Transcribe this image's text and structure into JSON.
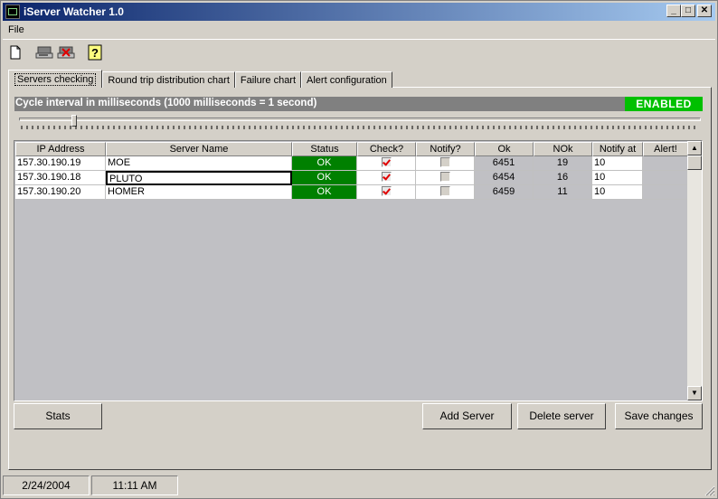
{
  "window": {
    "title": "iServer Watcher 1.0",
    "min_label": "_",
    "max_label": "□",
    "close_label": "✕"
  },
  "menu": {
    "items": [
      "File"
    ]
  },
  "toolbar": {
    "icons": [
      "new-document-icon",
      "server-icon",
      "delete-server-icon",
      "help-icon"
    ]
  },
  "tabs": [
    {
      "label": "Servers checking",
      "active": true
    },
    {
      "label": "Round trip distribution chart",
      "active": false
    },
    {
      "label": "Failure chart",
      "active": false
    },
    {
      "label": "Alert configuration",
      "active": false
    }
  ],
  "cycle": {
    "label": "Cycle interval in milliseconds (1000 milliseconds = 1 second)",
    "state": "ENABLED",
    "slider_level": 0.08
  },
  "grid": {
    "columns": [
      "IP Address",
      "Server Name",
      "Status",
      "Check?",
      "Notify?",
      "Ok",
      "NOk",
      "Notify at",
      "Alert!"
    ],
    "rows": [
      {
        "ip": "157.30.190.19",
        "name": "MOE",
        "status": "OK",
        "check": true,
        "notify": false,
        "ok": "6451",
        "nok": "19",
        "notify_at": "10",
        "alert": ""
      },
      {
        "ip": "157.30.190.18",
        "name": "PLUTO",
        "status": "OK",
        "check": true,
        "notify": false,
        "ok": "6454",
        "nok": "16",
        "notify_at": "10",
        "alert": ""
      },
      {
        "ip": "157.30.190.20",
        "name": "HOMER",
        "status": "OK",
        "check": true,
        "notify": false,
        "ok": "6459",
        "nok": "11",
        "notify_at": "10",
        "alert": ""
      }
    ]
  },
  "buttons": {
    "stats": "Stats",
    "add_server": "Add Server",
    "delete_server": "Delete server",
    "save_changes": "Save changes"
  },
  "status": {
    "date": "2/24/2004",
    "time": "11:11 AM"
  },
  "colors": {
    "status_ok": "#008000",
    "enabled": "#00c000",
    "title_start": "#0a246a"
  }
}
